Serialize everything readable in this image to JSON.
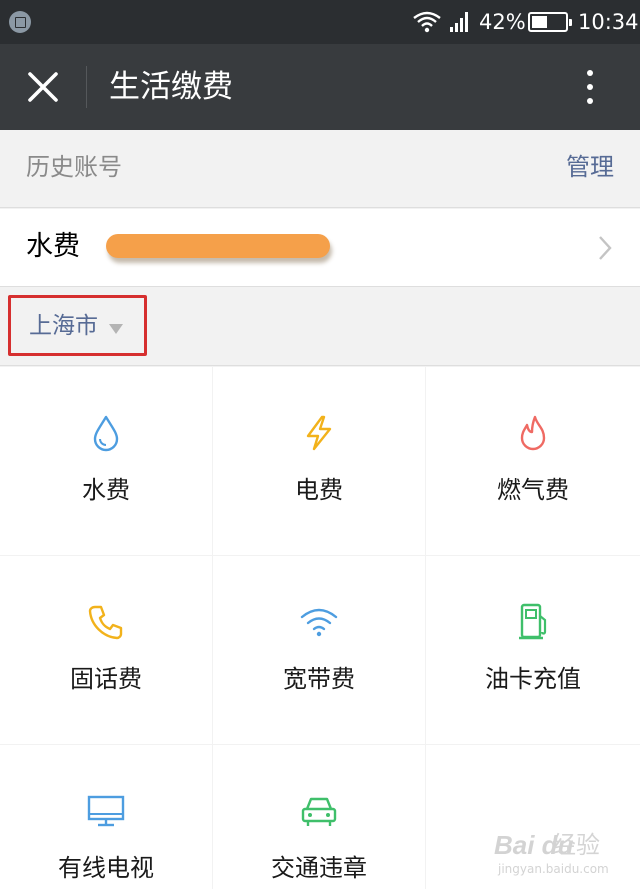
{
  "status_bar": {
    "battery_percent": "42%",
    "time": "10:34",
    "icons": [
      "gallery-notification-icon",
      "wifi-icon",
      "signal-icon",
      "battery-icon"
    ]
  },
  "title_bar": {
    "title": "生活缴费",
    "icons": [
      "close-icon",
      "more-vertical-icon"
    ]
  },
  "history": {
    "title": "历史账号",
    "manage_label": "管理",
    "accounts": [
      {
        "type": "水费",
        "number_redacted": true
      }
    ]
  },
  "city": {
    "name": "上海市",
    "highlight_color": "#d62f2f"
  },
  "services": [
    {
      "label": "水费",
      "icon": "water-drop-icon",
      "color": "#4d9de0"
    },
    {
      "label": "电费",
      "icon": "lightning-icon",
      "color": "#f2b21b"
    },
    {
      "label": "燃气费",
      "icon": "flame-icon",
      "color": "#ef6a63"
    },
    {
      "label": "固话费",
      "icon": "phone-icon",
      "color": "#f2b21b"
    },
    {
      "label": "宽带费",
      "icon": "wifi-icon",
      "color": "#4d9de0"
    },
    {
      "label": "油卡充值",
      "icon": "fuel-pump-icon",
      "color": "#3fbf6a"
    },
    {
      "label": "有线电视",
      "icon": "tv-monitor-icon",
      "color": "#4d9de0"
    },
    {
      "label": "交通违章",
      "icon": "car-icon",
      "color": "#3fbf6a"
    }
  ],
  "watermark": {
    "logo": "Bai du",
    "text": "经验",
    "url": "jingyan.baidu.com"
  },
  "colors": {
    "status_bar_bg": "#2b2e31",
    "title_bar_bg": "#383b3e",
    "link": "#576b95",
    "page_bg": "#f2f2f2"
  }
}
